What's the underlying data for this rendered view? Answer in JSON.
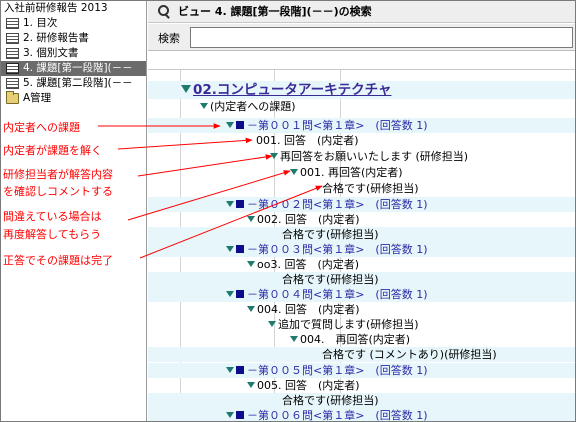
{
  "sidebar": {
    "db_title": "入社前研修報告 2013",
    "items": [
      {
        "label": "1. 目次",
        "icon": "view-icon",
        "selected": false
      },
      {
        "label": "2. 研修報告書",
        "icon": "view-icon",
        "selected": false
      },
      {
        "label": "3. 個別文書",
        "icon": "view-icon",
        "selected": false
      },
      {
        "label": "4. 課題[第一段階](－－",
        "icon": "view-icon",
        "selected": true
      },
      {
        "label": "5. 課題[第二段階](－－",
        "icon": "view-icon",
        "selected": false
      },
      {
        "label": "A管理",
        "icon": "folder-icon",
        "selected": false
      }
    ]
  },
  "header": {
    "icon": "search-icon",
    "title": "ビュー 4. 課題[第一段階](－－)の検索"
  },
  "search": {
    "label": "検索",
    "value": "",
    "placeholder": ""
  },
  "colors": {
    "row_highlight": "#e7f6fa",
    "twisty": "#1f7a6e",
    "bullet": "#0b0d8a",
    "category_text": "#2b2ba6",
    "annotation": "#ff0000",
    "selected_nav": "#6b6b6b"
  },
  "view": {
    "heading": "02.コンピュータアーキテクチャ",
    "subheading": "(内定者への課題)",
    "rows": [
      "－第００１問<第１章>　(回答数 1)",
      "001. 回答　(内定者)",
      "再回答をお願いいたします (研修担当)",
      "001. 再回答(内定者)",
      "合格です(研修担当)",
      "－第００２問<第１章>　(回答数 1)",
      "002. 回答　(内定者)",
      "合格です(研修担当)",
      "－第００３問<第１章>　(回答数 1)",
      "oo3. 回答　(内定者)",
      "合格です(研修担当)",
      "－第００４問<第１章>　(回答数 1)",
      "004. 回答　(内定者)",
      "追加で質問します(研修担当)",
      "004.　再回答(内定者)",
      "合格です (コメントあり)(研修担当)",
      "－第００５問<第１章>　(回答数 1)",
      "005. 回答　(内定者)",
      "合格です(研修担当)",
      "－第００６問<第１章>　(回答数 1)"
    ]
  },
  "annotations": [
    "内定者への課題",
    "内定者が課題を解く",
    "研修担当者が解答内容",
    "を確認しコメントする",
    "間違えている場合は",
    "再度解答してもらう",
    "正答でその課題は完了"
  ]
}
